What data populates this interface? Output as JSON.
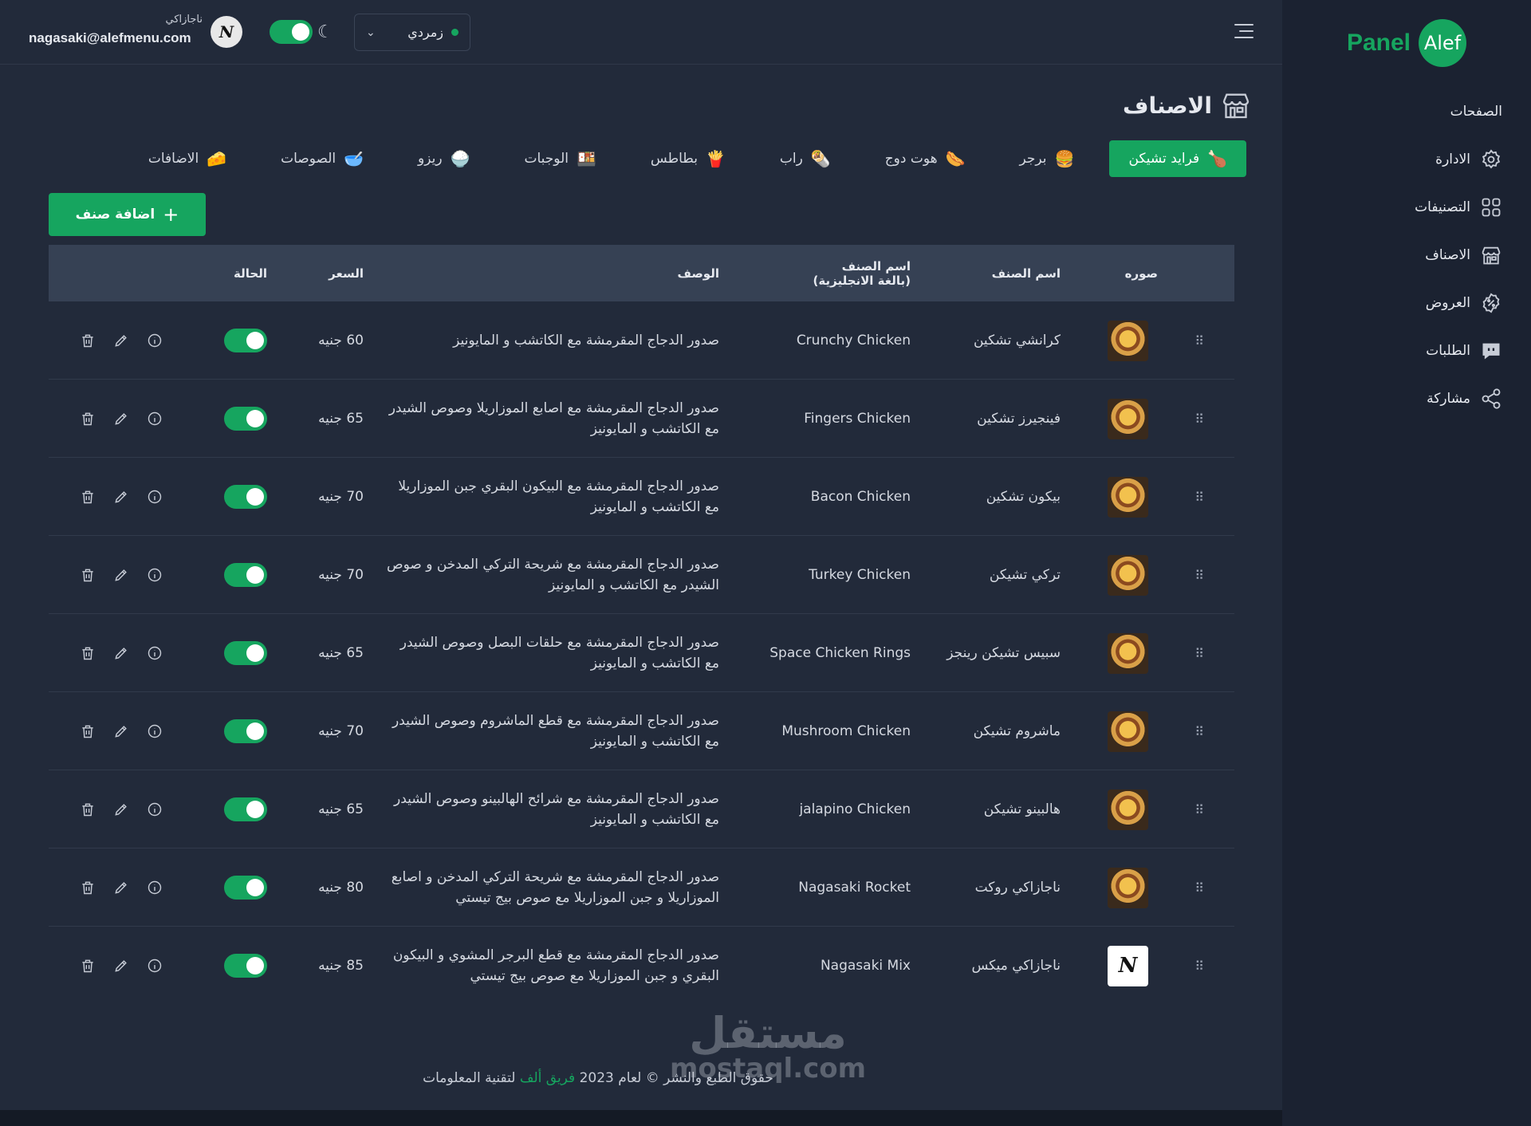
{
  "sidebar": {
    "logo_mark": "Alef",
    "logo_text": "Panel",
    "heading": "الصفحات",
    "items": [
      {
        "label": "الادارة",
        "icon": "gear-icon"
      },
      {
        "label": "التصنيفات",
        "icon": "grid-icon"
      },
      {
        "label": "الاصناف",
        "icon": "store-icon"
      },
      {
        "label": "العروض",
        "icon": "discount-icon"
      },
      {
        "label": "الطلبات",
        "icon": "chat-icon"
      },
      {
        "label": "مشاركة",
        "icon": "share-icon"
      }
    ]
  },
  "topbar": {
    "theme_value": "زمردي",
    "user_name": "ناجازاكي",
    "user_email": "nagasaki@alefmenu.com",
    "avatar_mark": "N"
  },
  "page": {
    "title": "الاصناف"
  },
  "tabs": [
    {
      "label": "فرايد تشيكن",
      "emoji": "🍗",
      "active": true
    },
    {
      "label": "برجر",
      "emoji": "🍔"
    },
    {
      "label": "هوت دوج",
      "emoji": "🌭"
    },
    {
      "label": "راب",
      "emoji": "🌯"
    },
    {
      "label": "بطاطس",
      "emoji": "🍟"
    },
    {
      "label": "الوجبات",
      "emoji": "🍱"
    },
    {
      "label": "ريزو",
      "emoji": "🍚"
    },
    {
      "label": "الصوصات",
      "emoji": "🥣"
    },
    {
      "label": "الاضافات",
      "emoji": "🧀"
    }
  ],
  "actions": {
    "add_label": "اضافة صنف"
  },
  "table": {
    "headers": {
      "image": "صوره",
      "name": "اسم الصنف",
      "name_en": "اسم الصنف (بالغة الانجليزية)",
      "description": "الوصف",
      "price": "السعر",
      "status": "الحالة"
    },
    "rows": [
      {
        "name": "كرانشي تشكين",
        "name_en": "Crunchy Chicken",
        "description": "صدور الدجاج المقرمشة مع الكاتشب و المايونيز",
        "price": "60 جنيه"
      },
      {
        "name": "فينجيرز تشكين",
        "name_en": "Fingers Chicken",
        "description": "صدور الدجاج المقرمشة مع اصابع الموزاريلا وصوص الشيدر مع الكاتشب و المايونيز",
        "price": "65 جنيه"
      },
      {
        "name": "بيكون تشكين",
        "name_en": "Bacon Chicken",
        "description": "صدور الدجاج المقرمشة مع البيكون البقري جبن الموزاريلا مع الكاتشب و المايونيز",
        "price": "70 جنيه"
      },
      {
        "name": "تركي تشيكن",
        "name_en": "Turkey Chicken",
        "description": "صدور الدجاج المقرمشة مع شريحة التركي المدخن و صوص الشيدر مع الكاتشب و المايونيز",
        "price": "70 جنيه"
      },
      {
        "name": "سبيس تشيكن رينجز",
        "name_en": "Space Chicken Rings",
        "description": "صدور الدجاج المقرمشة مع حلقات البصل وصوص الشيدر مع الكاتشب و المايونيز",
        "price": "65 جنيه"
      },
      {
        "name": "ماشروم تشيكن",
        "name_en": "Mushroom Chicken",
        "description": "صدور الدجاج المقرمشة مع قطع الماشروم وصوص الشيدر مع الكاتشب و المايونيز",
        "price": "70 جنيه"
      },
      {
        "name": "هالبينو تشيكن",
        "name_en": "jalapino Chicken",
        "description": "صدور الدجاج المقرمشة مع شرائح الهالبينو وصوص الشيدر مع الكاتشب و المايونيز",
        "price": "65 جنيه"
      },
      {
        "name": "ناجازاكي روكت",
        "name_en": "Nagasaki Rocket",
        "description": "صدور الدجاج المقرمشة مع شريحة التركي المدخن و اصابع الموزاريلا و جبن الموزاريلا مع صوص بيج تيستي",
        "price": "80 جنيه"
      },
      {
        "name": "ناجازاكي ميكس",
        "name_en": "Nagasaki Mix",
        "description": "صدور الدجاج المقرمشة مع قطع البرجر المشوي و البيكون البقري و جبن الموزاريلا مع صوص بيج تيستي",
        "price": "85 جنيه",
        "logo_mark": "N"
      }
    ]
  },
  "footer": {
    "prefix": "حقوق الطبع والنشر © لعام 2023",
    "team": "فريق ألف",
    "suffix": "لتقنية المعلومات"
  },
  "watermark": {
    "line1": "مستقل",
    "line2": "mostaql.com"
  },
  "colors": {
    "accent": "#16a55f",
    "sidebar_bg": "#1b2231",
    "main_bg": "#222a3a",
    "header_bg": "#364154"
  }
}
